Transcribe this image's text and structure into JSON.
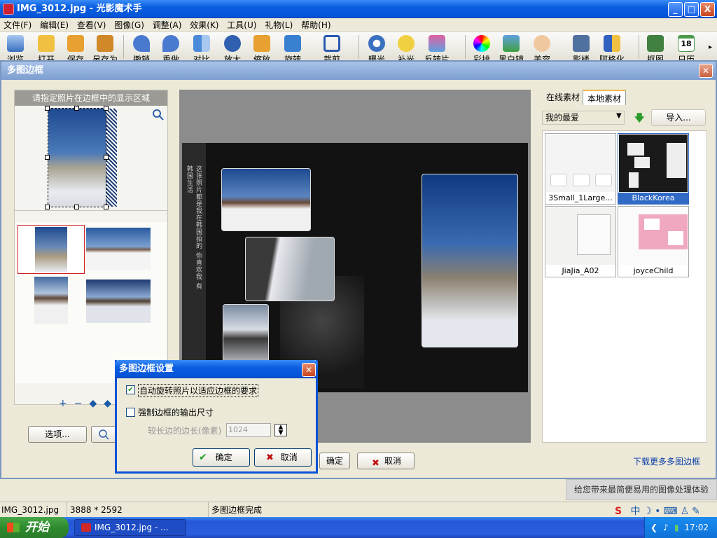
{
  "window": {
    "title": "IMG_3012.jpg - 光影魔术手",
    "min": "_",
    "max": "□",
    "close": "X"
  },
  "menu": [
    "文件(F)",
    "编辑(E)",
    "查看(V)",
    "图像(G)",
    "调整(A)",
    "效果(K)",
    "工具(U)",
    "礼物(L)",
    "帮助(H)"
  ],
  "toolbar": [
    "浏览",
    "打开",
    "保存",
    "另存为",
    "撤销",
    "重做",
    "对比",
    "放大",
    "缩放",
    "旋转",
    "裁剪",
    "曝光",
    "补光",
    "反转片",
    "彩排",
    "黑白镜",
    "美容",
    "影楼",
    "阿格化",
    "抠图",
    "日历"
  ],
  "calendar_day": "18",
  "dialog": {
    "title": "多图边框",
    "hint": "请指定照片在边框中的显示区域",
    "options_button": "选项...",
    "ok": "确定",
    "cancel": "取消",
    "vertical_caption": "这张照片都是我在韩国拍的 你喜欢我 有韩国生活",
    "download_more": "下载更多多图边框"
  },
  "right_panel": {
    "tabs": [
      "在线素材",
      "本地素材"
    ],
    "active_tab": "本地素材",
    "favorites": "我的最爱",
    "import": "导入...",
    "frames": [
      {
        "label": "3Small_1Large...",
        "selected": false
      },
      {
        "label": "BlackKorea",
        "selected": true
      },
      {
        "label": "JiaJia_A02",
        "selected": false
      },
      {
        "label": "joyceChild",
        "selected": false
      }
    ]
  },
  "settings": {
    "title": "多图边框设置",
    "auto_rotate": "自动旋转照片以适应边框的要求",
    "auto_rotate_checked": true,
    "force_size": "强制边框的输出尺寸",
    "force_size_checked": false,
    "long_side_label": "较长边的边长(像素)",
    "long_side_value": "1024",
    "ok": "确定",
    "cancel": "取消"
  },
  "slogan": "给您带来最简便易用的图像处理体验",
  "status": {
    "file": "IMG_3012.jpg",
    "size": "3888 * 2592",
    "message": "多图边框完成"
  },
  "taskbar": {
    "start": "开始",
    "task": "IMG_3012.jpg - ...",
    "time": "17:02"
  },
  "colors": {
    "titlebar": "#0a5ee0",
    "selection": "#316ac5",
    "link": "#0b3ea8"
  }
}
